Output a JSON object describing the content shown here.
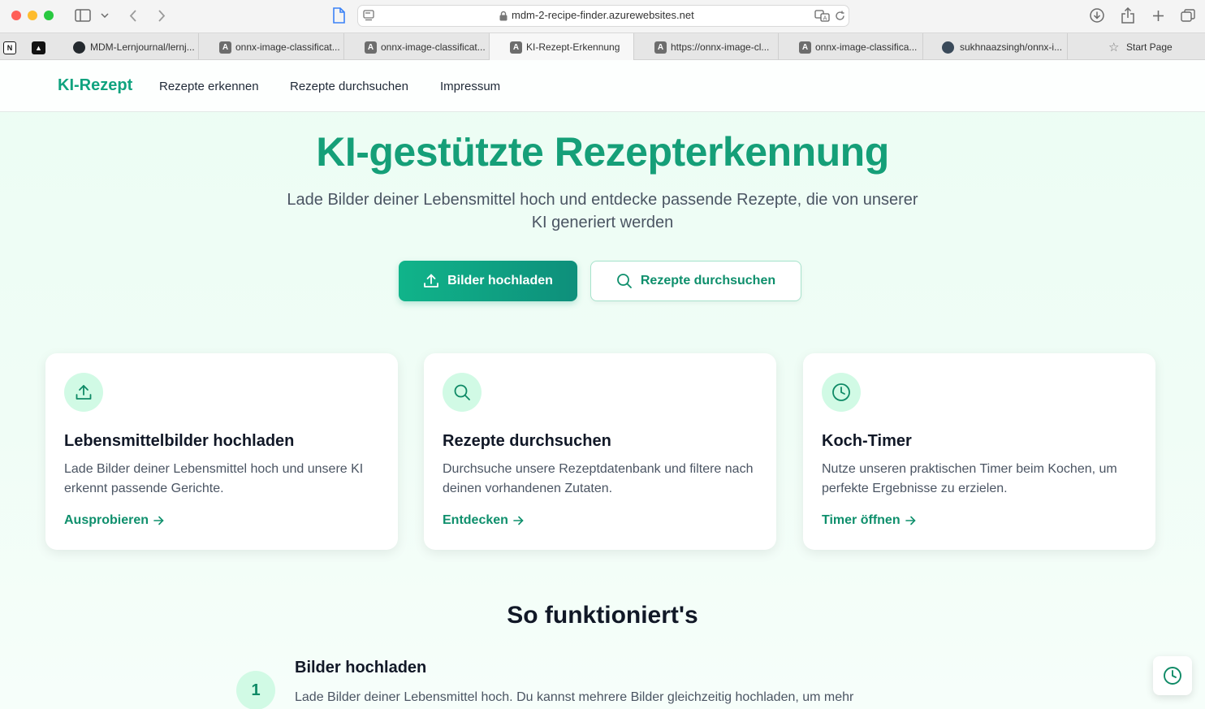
{
  "browser": {
    "url": "mdm-2-recipe-finder.azurewebsites.net",
    "tabs": [
      {
        "label": "MDM-Lernjournal/lernj...",
        "favicon": "github-icon"
      },
      {
        "label": "onnx-image-classificat...",
        "favicon": "A"
      },
      {
        "label": "onnx-image-classificat...",
        "favicon": "A"
      },
      {
        "label": "KI-Rezept-Erkennung",
        "favicon": "A",
        "active": true
      },
      {
        "label": "https://onnx-image-cl...",
        "favicon": "A"
      },
      {
        "label": "onnx-image-classifica...",
        "favicon": "A"
      },
      {
        "label": "sukhnaazsingh/onnx-i...",
        "favicon": "globe-icon"
      },
      {
        "label": "Start Page",
        "favicon": "star-icon"
      }
    ]
  },
  "nav": {
    "brand": "KI-Rezept",
    "links": [
      "Rezepte erkennen",
      "Rezepte durchsuchen",
      "Impressum"
    ]
  },
  "hero": {
    "title": "KI-gestützte Rezepterkennung",
    "subtitle": "Lade Bilder deiner Lebensmittel hoch und entdecke passende Rezepte, die von unserer KI generiert werden",
    "primary_button": "Bilder hochladen",
    "secondary_button": "Rezepte durchsuchen"
  },
  "features": [
    {
      "icon": "upload-icon",
      "title": "Lebensmittelbilder hochladen",
      "text": "Lade Bilder deiner Lebensmittel hoch und unsere KI erkennt passende Gerichte.",
      "link": "Ausprobieren"
    },
    {
      "icon": "search-icon",
      "title": "Rezepte durchsuchen",
      "text": "Durchsuche unsere Rezeptdatenbank und filtere nach deinen vorhandenen Zutaten.",
      "link": "Entdecken"
    },
    {
      "icon": "clock-icon",
      "title": "Koch-Timer",
      "text": "Nutze unseren praktischen Timer beim Kochen, um perfekte Ergebnisse zu erzielen.",
      "link": "Timer öffnen"
    }
  ],
  "how": {
    "title": "So funktioniert's",
    "steps": [
      {
        "number": "1",
        "title": "Bilder hochladen",
        "text": "Lade Bilder deiner Lebensmittel hoch. Du kannst mehrere Bilder gleichzeitig hochladen, um mehr"
      }
    ]
  },
  "colors": {
    "brand": "#10a37f",
    "accent_light": "#d1fae5",
    "link": "#0e8f6c"
  }
}
